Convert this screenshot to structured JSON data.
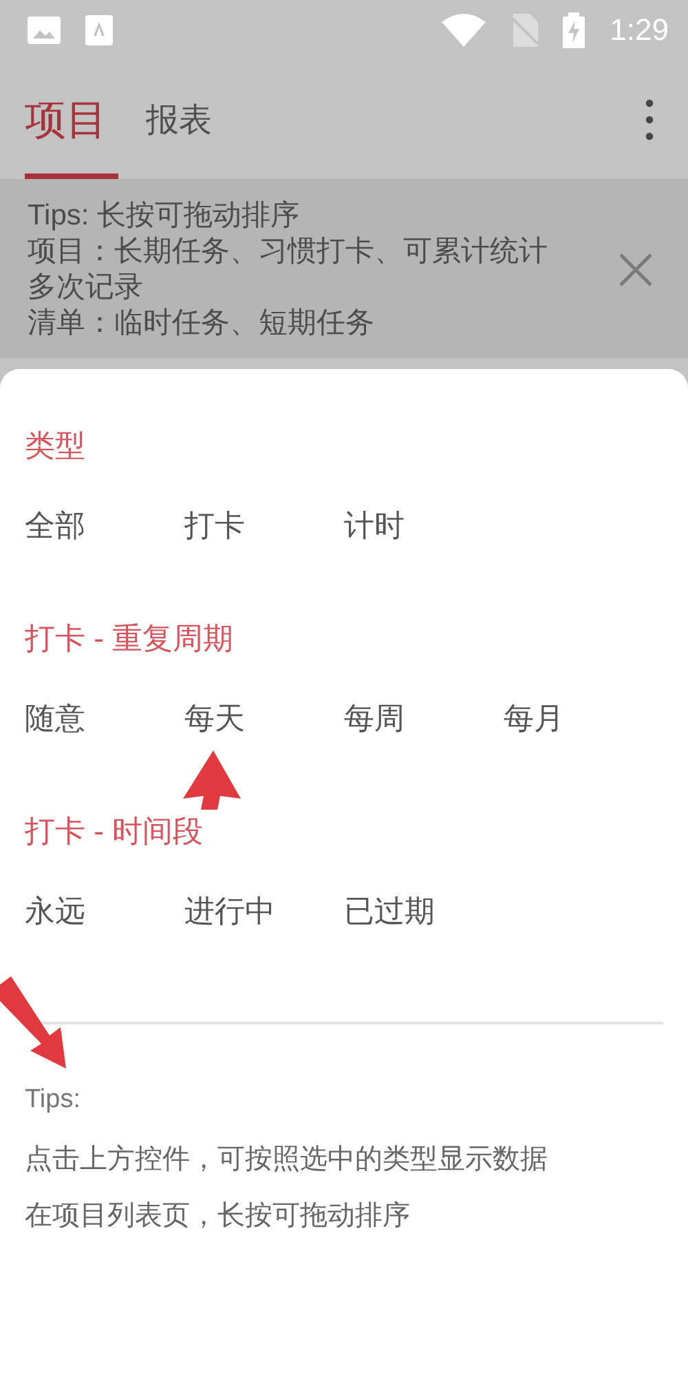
{
  "status_bar": {
    "time": "1:29"
  },
  "tabs": [
    {
      "label": "项目",
      "selected": true
    },
    {
      "label": "报表",
      "selected": false
    }
  ],
  "tips_banner": {
    "lines": [
      "Tips: 长按可拖动排序",
      "项目：长期任务、习惯打卡、可累计统计多次记录",
      "清单：临时任务、短期任务"
    ]
  },
  "filter_sections": [
    {
      "heading": "类型",
      "options": [
        "全部",
        "打卡",
        "计时"
      ]
    },
    {
      "heading": "打卡 - 重复周期",
      "options": [
        "随意",
        "每天",
        "每周",
        "每月"
      ]
    },
    {
      "heading": "打卡 - 时间段",
      "options": [
        "永远",
        "进行中",
        "已过期"
      ]
    }
  ],
  "tips": {
    "title": "Tips:",
    "lines": [
      "点击上方控件，可按照选中的类型显示数据",
      "在项目列表页，长按可拖动排序"
    ]
  }
}
